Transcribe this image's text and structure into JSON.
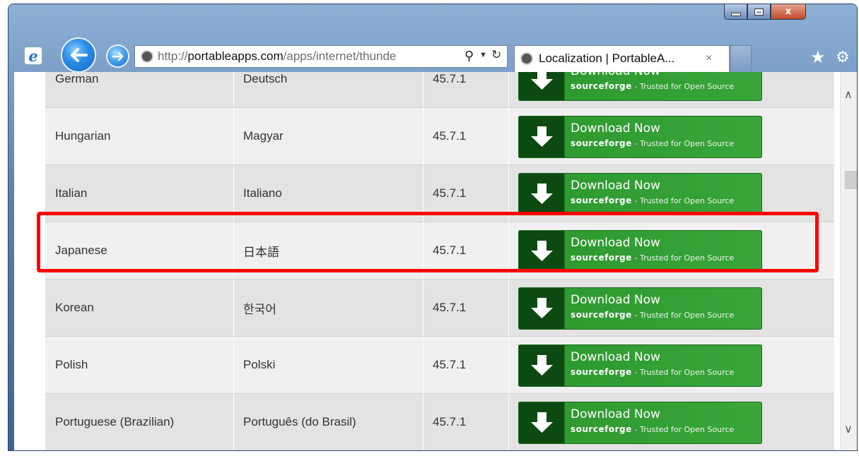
{
  "browser": {
    "address": {
      "url_prefix": "http://",
      "url_domain": "portableapps.com",
      "url_rest": "/apps/internet/thunde"
    },
    "tab": {
      "title": "Localization | PortableA...",
      "close": "×"
    },
    "window_controls": {
      "close": "x"
    },
    "icons": [
      "ie-logo-icon",
      "back-arrow-icon",
      "forward-arrow-icon",
      "search-icon",
      "dropdown-icon",
      "refresh-icon",
      "favorites-star-icon",
      "settings-gear-icon"
    ]
  },
  "table": {
    "rows": [
      {
        "language": "German",
        "native": "Deutsch",
        "version": "45.7.1"
      },
      {
        "language": "Hungarian",
        "native": "Magyar",
        "version": "45.7.1"
      },
      {
        "language": "Italian",
        "native": "Italiano",
        "version": "45.7.1"
      },
      {
        "language": "Japanese",
        "native": "日本語",
        "version": "45.7.1"
      },
      {
        "language": "Korean",
        "native": "한국어",
        "version": "45.7.1"
      },
      {
        "language": "Polish",
        "native": "Polski",
        "version": "45.7.1"
      },
      {
        "language": "Portuguese (Brazilian)",
        "native": "Português (do Brasil)",
        "version": "45.7.1"
      }
    ],
    "download_button": {
      "label": "Download Now",
      "brand": "sourceforge",
      "tagline": "- Trusted for Open Source"
    }
  },
  "highlight": {
    "color": "#ff0000",
    "row_language": "Japanese"
  },
  "colors": {
    "button_dark": "#0d4a12",
    "button_green": "#3aa53a",
    "row_odd": "#e3e3e3",
    "row_even": "#f0f0f0"
  }
}
